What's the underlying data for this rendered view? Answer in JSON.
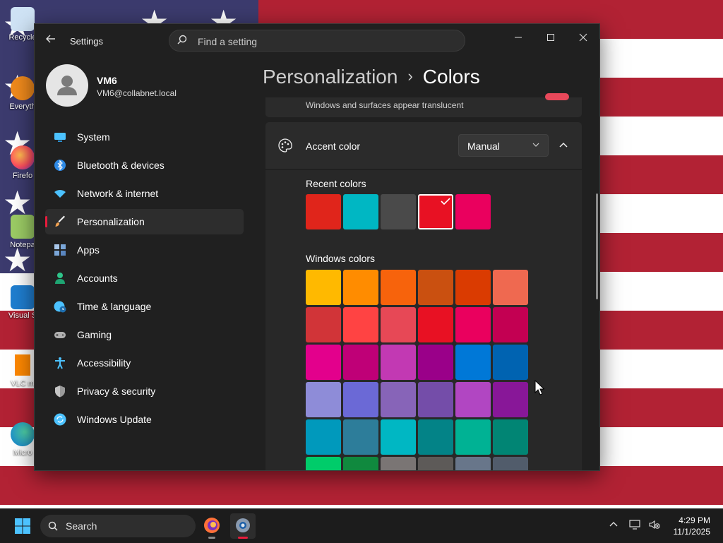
{
  "desktop": {
    "icons": [
      {
        "label": "Recycle"
      },
      {
        "label": "Everyth"
      },
      {
        "label": "Firefo"
      },
      {
        "label": "Notepa"
      },
      {
        "label": "Visual S"
      },
      {
        "label": "VLC m"
      },
      {
        "label": "Micro"
      }
    ]
  },
  "window": {
    "title": "Settings",
    "search_placeholder": "Find a setting"
  },
  "profile": {
    "name": "VM6",
    "email": "VM6@collabnet.local"
  },
  "nav": {
    "items": [
      {
        "label": "System",
        "icon": "monitor-icon",
        "color": "#4cc2ff"
      },
      {
        "label": "Bluetooth & devices",
        "icon": "bluetooth-icon",
        "color": "#2e8ae6"
      },
      {
        "label": "Network & internet",
        "icon": "wifi-icon",
        "color": "#4cc2ff"
      },
      {
        "label": "Personalization",
        "icon": "paintbrush-icon",
        "color": "#f0a050"
      },
      {
        "label": "Apps",
        "icon": "apps-icon",
        "color": "#7aa6d8"
      },
      {
        "label": "Accounts",
        "icon": "person-icon",
        "color": "#2fc48a"
      },
      {
        "label": "Time & language",
        "icon": "globe-clock-icon",
        "color": "#4cc2ff"
      },
      {
        "label": "Gaming",
        "icon": "gamepad-icon",
        "color": "#b0b0b0"
      },
      {
        "label": "Accessibility",
        "icon": "accessibility-icon",
        "color": "#4cc2ff"
      },
      {
        "label": "Privacy & security",
        "icon": "shield-icon",
        "color": "#9a9a9a"
      },
      {
        "label": "Windows Update",
        "icon": "update-icon",
        "color": "#4cc2ff"
      }
    ],
    "active": "Personalization"
  },
  "breadcrumb": {
    "parent": "Personalization",
    "separator": "›",
    "current": "Colors"
  },
  "transparency": {
    "description": "Windows and surfaces appear translucent"
  },
  "accent": {
    "label": "Accent color",
    "mode": "Manual",
    "recent_label": "Recent colors",
    "recent_colors": [
      "#e0251b",
      "#00b7c3",
      "#4a4a4a",
      "#e81123",
      "#ea005e"
    ],
    "selected_recent": "#e81123",
    "windows_label": "Windows colors",
    "windows_colors": [
      [
        "#ffb900",
        "#ff8c00",
        "#f7630c",
        "#ca5010",
        "#da3b01",
        "#ef6950"
      ],
      [
        "#d13438",
        "#ff4343",
        "#e74856",
        "#e81123",
        "#ea005e",
        "#c30052"
      ],
      [
        "#e3008c",
        "#bf0077",
        "#c239b3",
        "#9a0089",
        "#0078d7",
        "#0063b1"
      ],
      [
        "#8e8cd8",
        "#6b69d6",
        "#8764b8",
        "#744da9",
        "#b146c2",
        "#881798"
      ],
      [
        "#0099bc",
        "#2d7d9a",
        "#00b7c3",
        "#038387",
        "#00b294",
        "#018574"
      ],
      [
        "#00cc6a",
        "#10893e",
        "#7a7574",
        "#5d5a58",
        "#68768a",
        "#515c6b"
      ]
    ]
  },
  "taskbar": {
    "search_label": "Search",
    "time": "4:29 PM",
    "date": "11/1/2025"
  }
}
